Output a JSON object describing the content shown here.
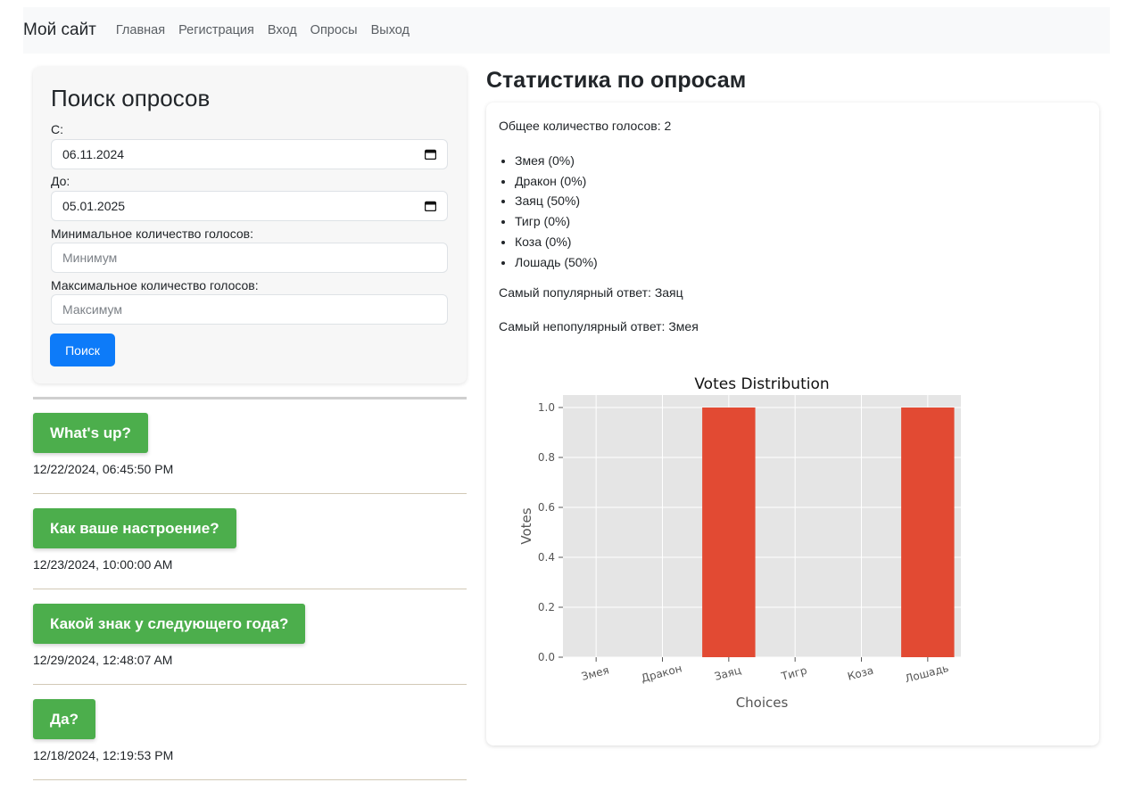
{
  "nav": {
    "brand": "Мой сайт",
    "links": [
      "Главная",
      "Регистрация",
      "Вход",
      "Опросы",
      "Выход"
    ]
  },
  "search": {
    "title": "Поиск опросов",
    "from_label": "С:",
    "from_value": "06.11.2024",
    "to_label": "До:",
    "to_value": "05.01.2025",
    "min_label": "Минимальное количество голосов:",
    "min_placeholder": "Минимум",
    "max_label": "Максимальное количество голосов:",
    "max_placeholder": "Максимум",
    "button": "Поиск"
  },
  "polls": [
    {
      "title": "What's up?",
      "date": "12/22/2024, 06:45:50 PM"
    },
    {
      "title": "Как ваше настроение?",
      "date": "12/23/2024, 10:00:00 AM"
    },
    {
      "title": "Какой знак у следующего года?",
      "date": "12/29/2024, 12:48:07 AM"
    },
    {
      "title": "Да?",
      "date": "12/18/2024, 12:19:53 PM"
    }
  ],
  "stats": {
    "title": "Статистика по опросам",
    "total": "Общее количество голосов: 2",
    "items": [
      "Змея (0%)",
      "Дракон (0%)",
      "Заяц (50%)",
      "Тигр (0%)",
      "Коза (0%)",
      "Лошадь (50%)"
    ],
    "most_popular": "Самый популярный ответ: Заяц",
    "least_popular": "Самый непопулярный ответ: Змея"
  },
  "colors": {
    "bar": "#e24a33",
    "plot_bg": "#e5e5e5",
    "button_primary": "#0d7bf9",
    "button_poll": "#4cae4c"
  },
  "chart_data": {
    "type": "bar",
    "title": "Votes Distribution",
    "xlabel": "Choices",
    "ylabel": "Votes",
    "categories": [
      "Змея",
      "Дракон",
      "Заяц",
      "Тигр",
      "Коза",
      "Лошадь"
    ],
    "values": [
      0,
      0,
      1,
      0,
      0,
      1
    ],
    "ylim": [
      0,
      1.05
    ],
    "yticks": [
      "0.0",
      "0.2",
      "0.4",
      "0.6",
      "0.8",
      "1.0"
    ],
    "grid": true
  }
}
